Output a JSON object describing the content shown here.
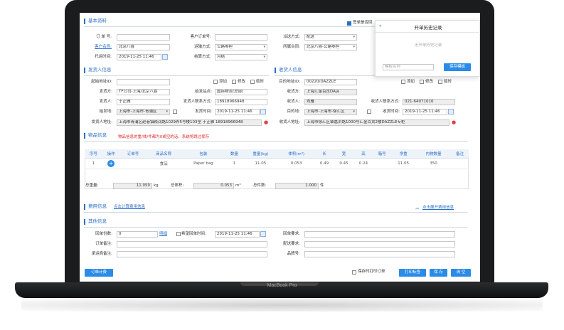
{
  "device": {
    "brand_label": "MacBook Pro"
  },
  "sections": {
    "basic": "基本资料",
    "sender": "发货人信息",
    "receiver": "收货人信息",
    "goods": "物品信息",
    "goods_note": "物品信息的重/体/件都为0或空的话，系统将跳过保存",
    "fees": "费用信息",
    "fees_link": "点击计算费用信息",
    "fees_expand": "点击展开费用信息",
    "other": "其他信息"
  },
  "basic": {
    "order_no_label": "订 单 号:",
    "order_no_value": "",
    "customer_name_label": "客户名称:",
    "customer_name_value": "北京八喜",
    "consign_time_label": "托运时间:",
    "consign_time_value": "2019-11-25 11:46",
    "customer_order_label": "客户订单号:",
    "customer_order_value": "",
    "transport_label": "运输方式:",
    "transport_value": "公路零担",
    "settle_label": "结算方式:",
    "settle_value": "月结",
    "dispatch_label": "派送方式:",
    "dispatch_value": "配送",
    "contract_label": "所属合同:",
    "contract_value": "北京八喜-公路零担",
    "receipt_label": "签单是否回",
    "receipt_checked": true
  },
  "sender": {
    "start_id_label": "起始地址ID:",
    "start_id_value": "",
    "shipper_label": "发货方:",
    "shipper_value": "TF公司-上海/北京八喜",
    "contact_label": "发货人:",
    "contact_value": "于正雅",
    "origin_label": "始发地:",
    "origin_value": "上海市-上海市-青浦区",
    "address_label": "发货人地址:",
    "address_value": "上海市青浦区赵巷镇崧润路1029弄5号楼103室 于正雅 18918966948",
    "station_label": "始发站点:",
    "station_value": "国际物流(总部)",
    "phone_label": "发货人联系方式:",
    "phone_value": "18918966948",
    "ship_time_label": "发货时间:",
    "ship_time_value": "2019-11-25 11:46",
    "add_label": "添加",
    "edit_label": "修改",
    "temp_label": "临时"
  },
  "receiver": {
    "dest_id_label": "目的地址ID:",
    "dest_id_value": "00220/DAZZLE",
    "consignee_label": "收货方:",
    "consignee_value": "上海汇金百货DA店",
    "contact_label": "收货人:",
    "contact_value": "刘雁",
    "dest_label": "目的地:",
    "dest_value": "上海市-上海市-徐汇区",
    "address_label": "收货人地址:",
    "address_value": "上海市徐汇区肇嘉浜路1000号汇金百货2楼DAZZLE专柜",
    "phone_label": "收货人联系方式:",
    "phone_value": "021-64071016",
    "recv_time_label": "收货时间:",
    "recv_time_value": "2019-11-25 11:46",
    "add_label": "添加",
    "edit_label": "修改",
    "temp_label": "临时"
  },
  "goods_table": {
    "headers": [
      "序号",
      "操作",
      "订单号",
      "商品名称",
      "包装",
      "数量",
      "重量(kg)",
      "体积(m³)",
      "长",
      "宽",
      "高",
      "箱号",
      "净重",
      "内物数量",
      "备注"
    ],
    "rows": [
      [
        "1",
        "",
        "",
        "食品",
        "Paper bag",
        "1",
        "11.05",
        "0.053",
        "0.49",
        "0.45",
        "0.24",
        "",
        "11.05",
        "350",
        ""
      ]
    ]
  },
  "totals": {
    "weight_label": "总重量:",
    "weight_value": "11.050",
    "weight_unit": "kg",
    "volume_label": "总体积:",
    "volume_value": "0.053",
    "volume_unit": "m³",
    "pieces_label": "总件数:",
    "pieces_value": "1.000",
    "pieces_unit": "件"
  },
  "other": {
    "receipt_count_label": "回单份数:",
    "receipt_count_value": "0",
    "detail_label": "明细",
    "expect_label": "希望回单时间:",
    "expect_value": "2019-11-25 11:46",
    "receipt_req_label": "回单要求:",
    "order_note_label": "订单备注:",
    "delivery_req_label": "配送要求:",
    "carrier_note_label": "承运商备注:",
    "brand_label": "品牌号:"
  },
  "actions": {
    "order_fee": "订单计费",
    "save_print": "保存时打印订单",
    "print_label": "打印标签",
    "save": "保 存",
    "clear": "清 空"
  },
  "popup": {
    "title": "开单历史记录",
    "empty": "无开单历史记录",
    "close_glyph": "»",
    "template_placeholder": "模板名称",
    "save_template": "保存模板"
  }
}
